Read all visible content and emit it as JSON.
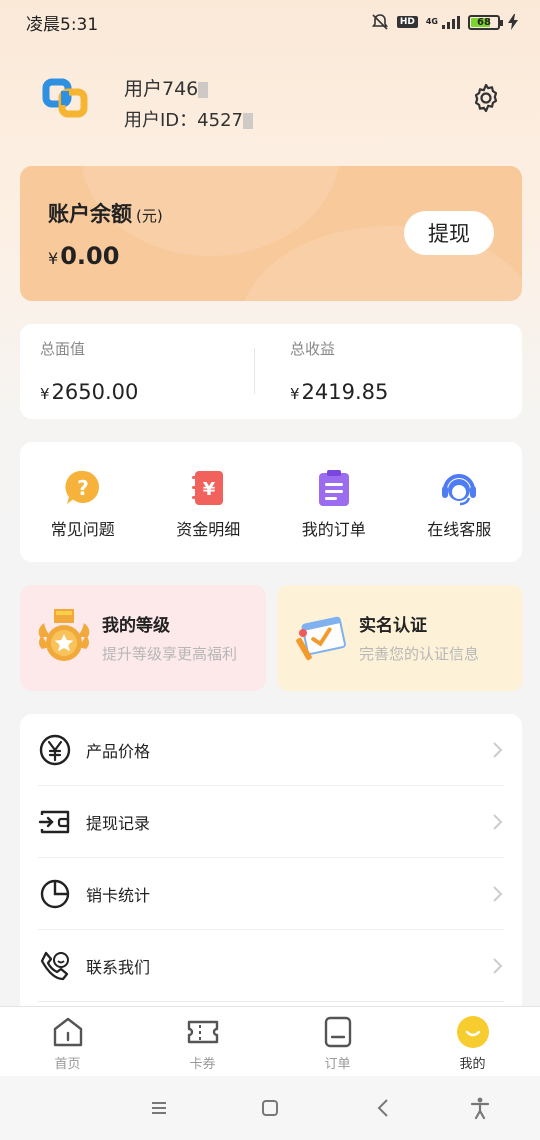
{
  "status_bar": {
    "time": "凌晨5:31",
    "hd": "HD",
    "network": "4G",
    "battery": "68"
  },
  "profile": {
    "username": "用户746",
    "user_id_label": "用户ID：",
    "user_id": "4527"
  },
  "balance": {
    "title": "账户余额",
    "unit": "(元)",
    "currency": "¥",
    "amount": "0.00",
    "withdraw_label": "提现"
  },
  "totals": [
    {
      "label": "总面值",
      "currency": "¥",
      "value": "2650.00"
    },
    {
      "label": "总收益",
      "currency": "¥",
      "value": "2419.85"
    }
  ],
  "quick_actions": [
    {
      "label": "常见问题",
      "icon": "question-icon",
      "color": "#f7b23b"
    },
    {
      "label": "资金明细",
      "icon": "money-detail-icon",
      "color": "#f0625b"
    },
    {
      "label": "我的订单",
      "icon": "order-icon",
      "color": "#9b6bf0"
    },
    {
      "label": "在线客服",
      "icon": "customer-service-icon",
      "color": "#4f7cf0"
    }
  ],
  "promos": {
    "level": {
      "title": "我的等级",
      "subtitle": "提升等级享更高福利",
      "icon": "medal-icon"
    },
    "verify": {
      "title": "实名认证",
      "subtitle": "完善您的认证信息",
      "icon": "certificate-icon"
    }
  },
  "menu": [
    {
      "label": "产品价格",
      "icon": "yen-circle-icon"
    },
    {
      "label": "提现记录",
      "icon": "withdraw-record-icon"
    },
    {
      "label": "销卡统计",
      "icon": "pie-chart-icon"
    },
    {
      "label": "联系我们",
      "icon": "phone-contact-icon"
    }
  ],
  "tabbar": [
    {
      "label": "首页",
      "icon": "home-icon"
    },
    {
      "label": "卡券",
      "icon": "ticket-icon"
    },
    {
      "label": "订单",
      "icon": "order-tab-icon"
    },
    {
      "label": "我的",
      "icon": "mine-smile-icon",
      "active": true
    }
  ],
  "colors": {
    "accent": "#f8c99a",
    "active_tab": "#f7cc2f"
  }
}
